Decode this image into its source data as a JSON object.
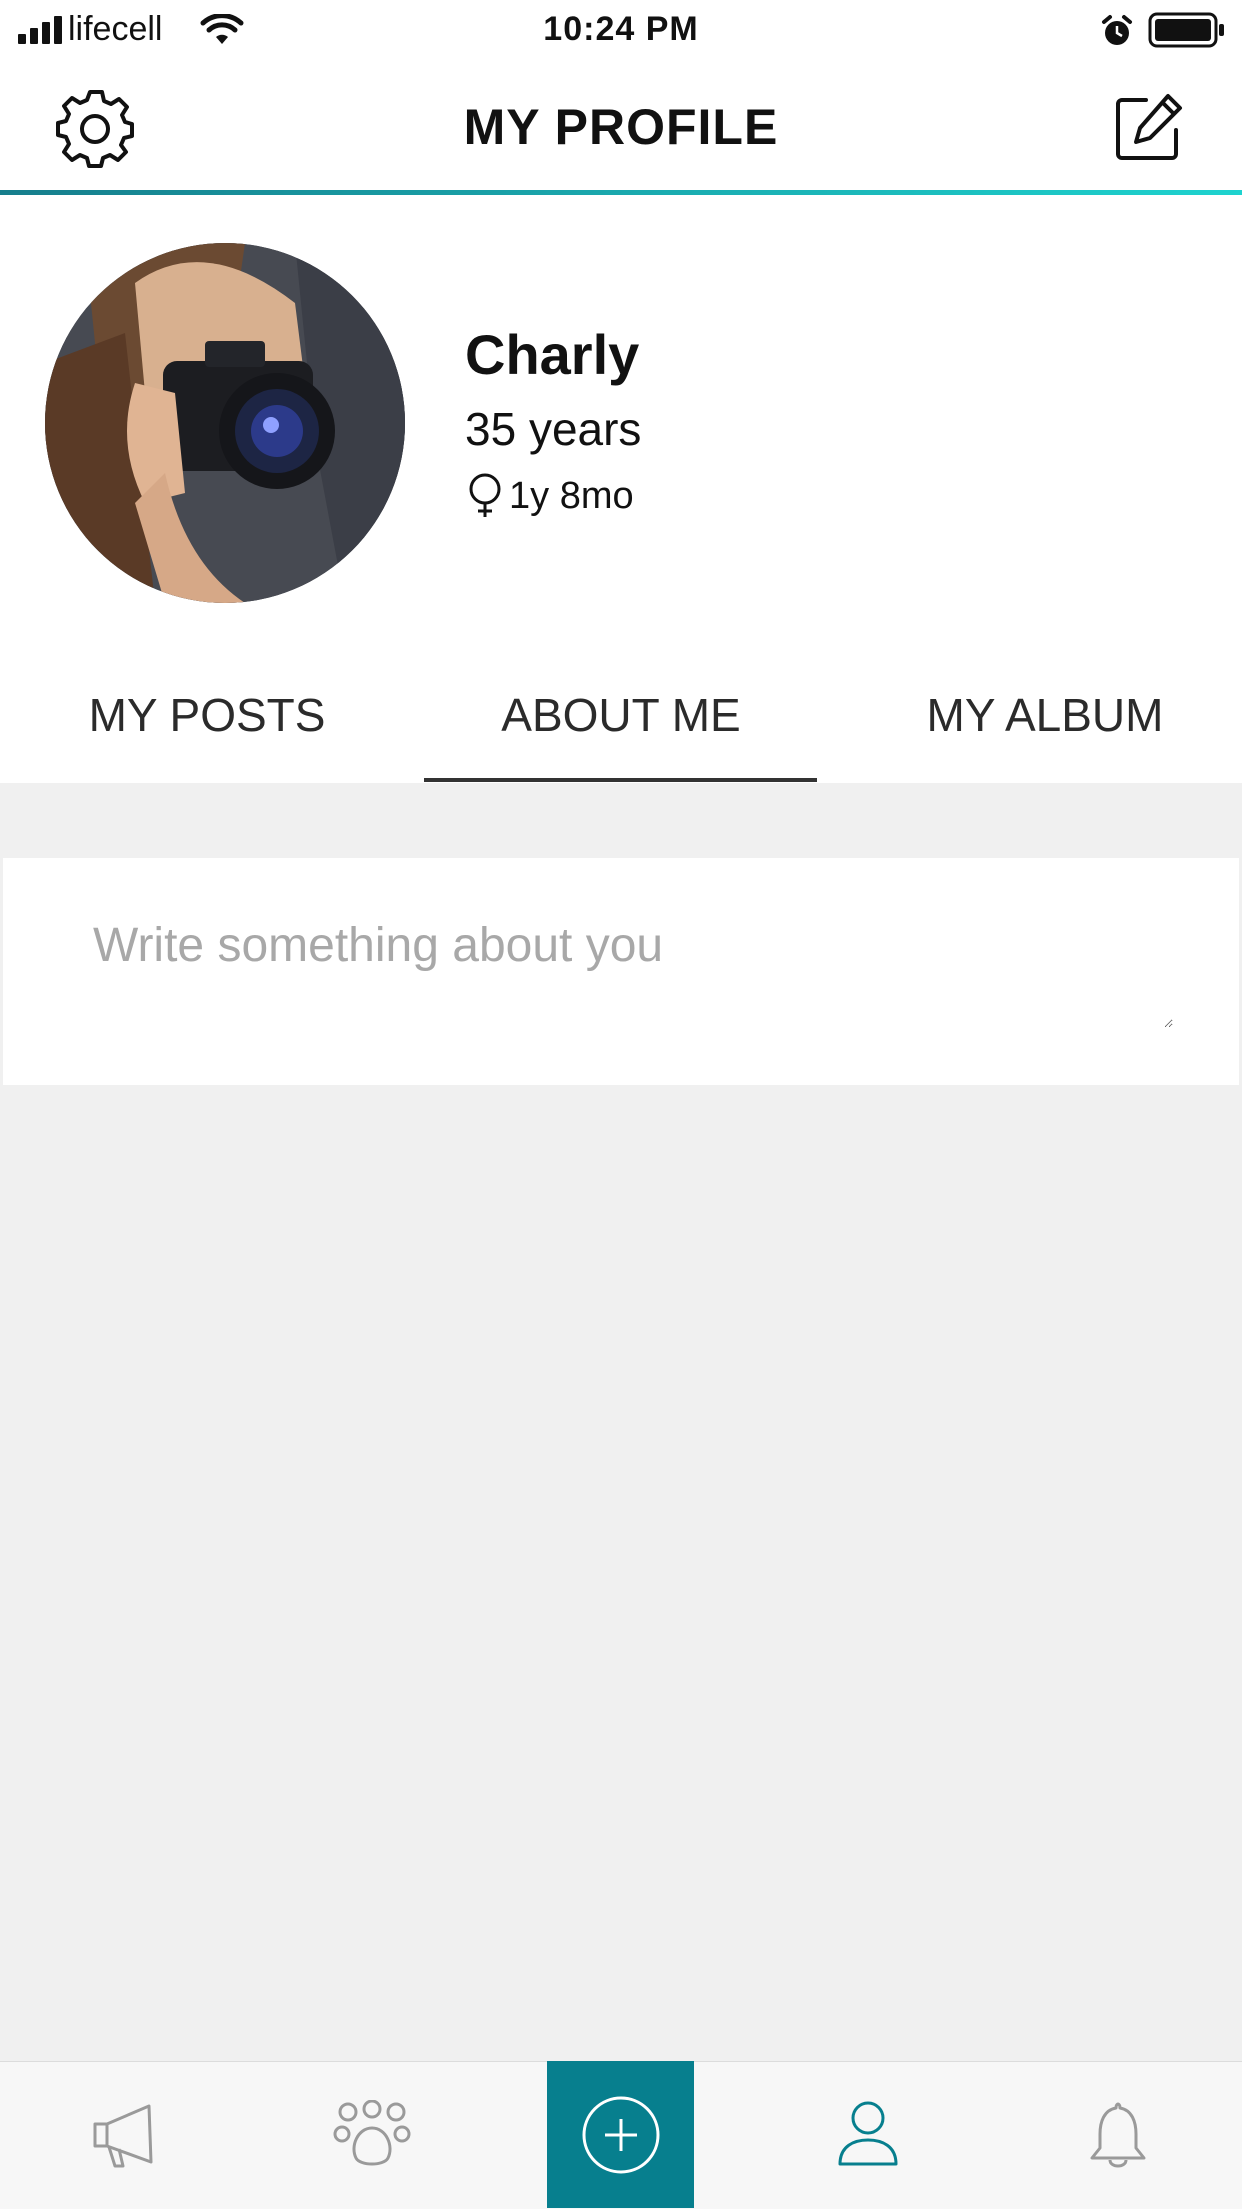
{
  "status_bar": {
    "carrier": "lifecell",
    "time": "10:24 PM"
  },
  "header": {
    "title": "MY PROFILE",
    "left_icon": "gear-icon",
    "right_icon": "edit-icon"
  },
  "profile": {
    "name": "Charly",
    "age": "35 years",
    "member_since": "1y 8mo"
  },
  "tabs": [
    {
      "label": "MY POSTS",
      "active": false
    },
    {
      "label": "ABOUT ME",
      "active": true
    },
    {
      "label": "MY ALBUM",
      "active": false
    }
  ],
  "about": {
    "placeholder": "Write something about you",
    "value": ""
  },
  "bottom_nav": [
    {
      "icon": "megaphone-icon",
      "active": false
    },
    {
      "icon": "group-icon",
      "active": false
    },
    {
      "icon": "add-icon",
      "active": false
    },
    {
      "icon": "profile-icon",
      "active": true
    },
    {
      "icon": "bell-icon",
      "active": false
    }
  ],
  "colors": {
    "accent": "#077f8e",
    "accent_light": "#1ed3cf",
    "active_icon": "#077f8e",
    "inactive_icon": "#9a9a9a"
  }
}
